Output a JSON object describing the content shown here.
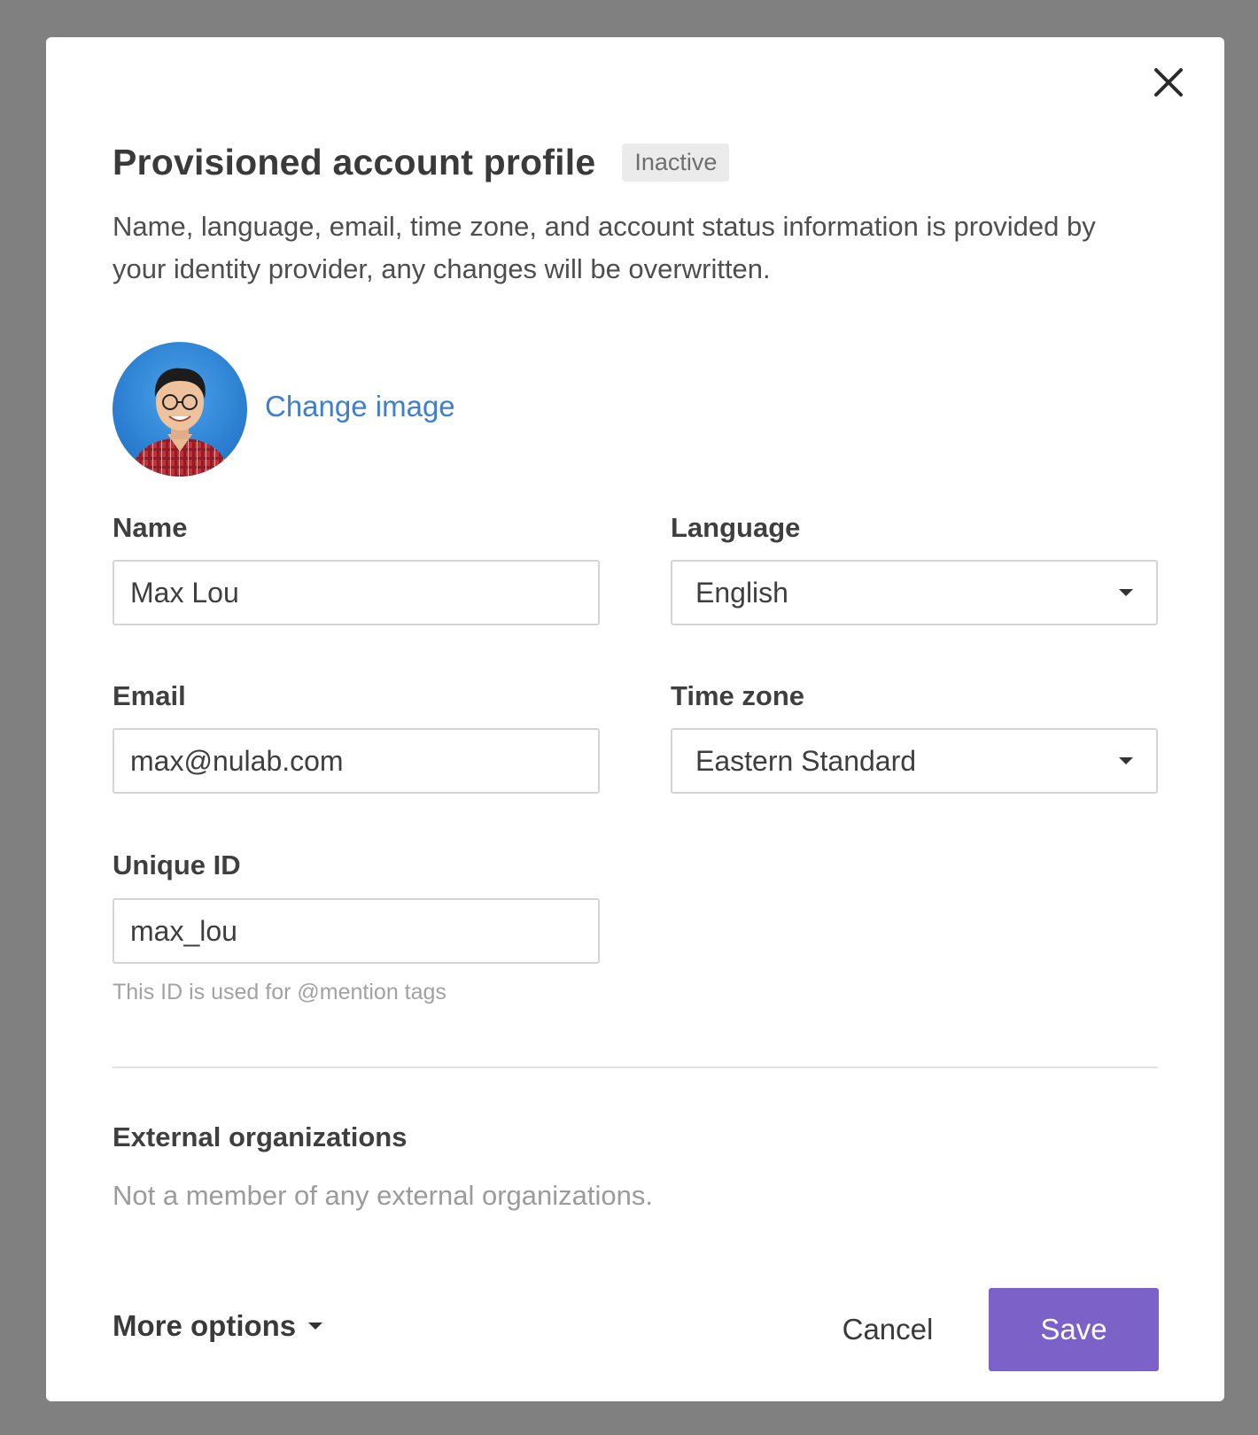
{
  "dialog": {
    "title": "Provisioned account profile",
    "status_badge": "Inactive",
    "description": "Name, language, email, time zone, and account status information is provided by your identity provider, any changes will be overwritten.",
    "close_icon": "close-icon"
  },
  "profile": {
    "avatar_icon": "user-avatar-photo",
    "change_image_label": "Change image"
  },
  "fields": {
    "name": {
      "label": "Name",
      "value": "Max Lou"
    },
    "language": {
      "label": "Language",
      "value": "English"
    },
    "email": {
      "label": "Email",
      "value": "max@nulab.com"
    },
    "timezone": {
      "label": "Time zone",
      "value": "Eastern Standard"
    },
    "unique_id": {
      "label": "Unique ID",
      "value": "max_lou",
      "helper": "This ID is used for @mention tags"
    }
  },
  "external_orgs": {
    "title": "External organizations",
    "empty_text": "Not a member of any external organizations."
  },
  "footer": {
    "more_options_label": "More options",
    "cancel_label": "Cancel",
    "save_label": "Save"
  },
  "colors": {
    "overlay": "#808080",
    "link": "#3d7fd1",
    "primary_button": "#7b61c8"
  }
}
